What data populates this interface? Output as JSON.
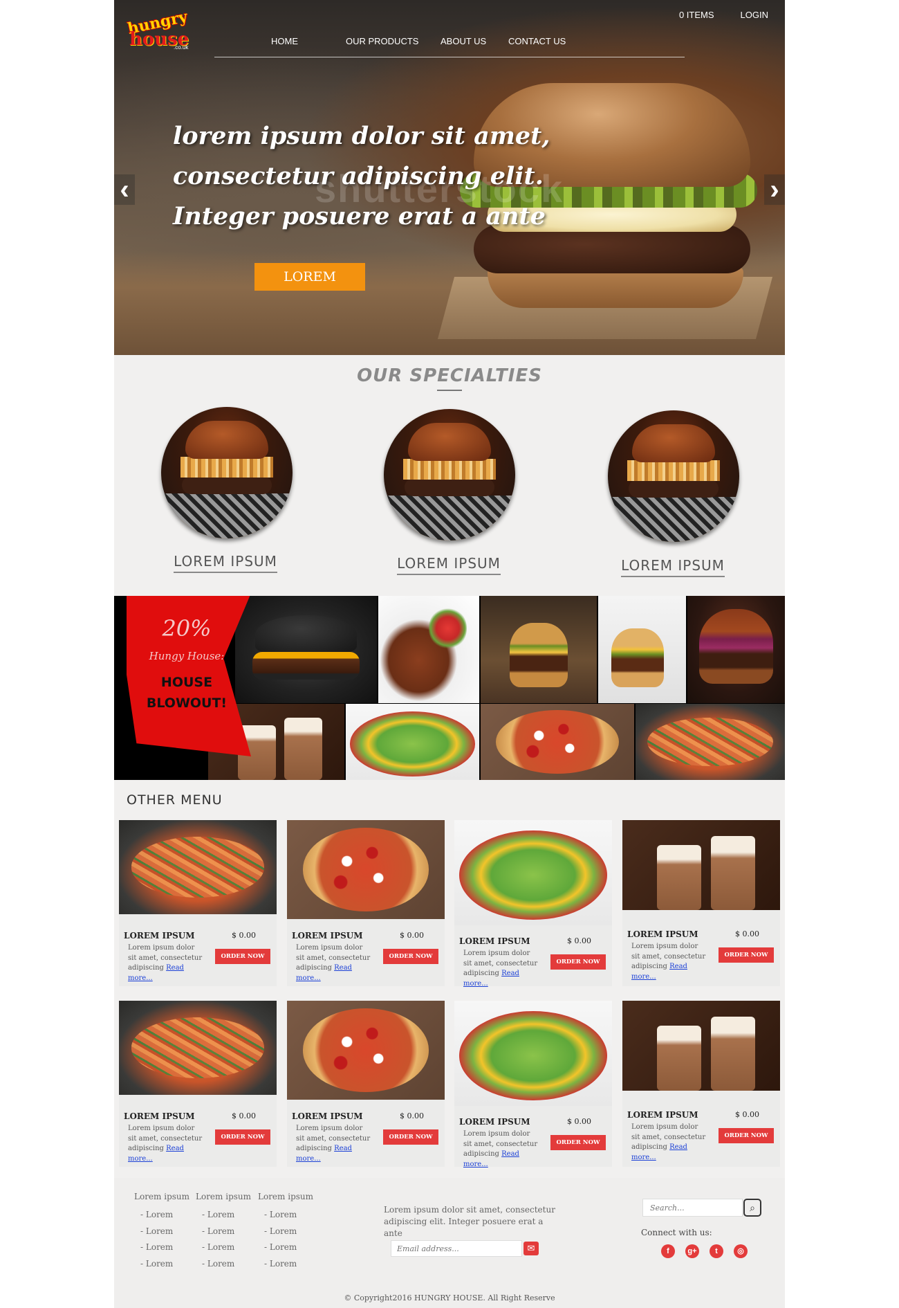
{
  "brand": {
    "logo_line1": "hungry",
    "logo_line2": "house",
    "logo_domain": ".co.uk"
  },
  "topbar": {
    "items_count": "0 ITEMS",
    "login": "LOGIN"
  },
  "nav": [
    "HOME",
    "OUR PRODUCTS",
    "ABOUT US",
    "CONTACT US"
  ],
  "hero": {
    "lines": [
      "lorem ipsum dolor sit amet,",
      "consectetur adipiscing elit.",
      "Integer posuere erat a ante"
    ],
    "button": "LOREM",
    "watermark": "shutterstock",
    "prev_icon": "chevron-left-icon",
    "next_icon": "chevron-right-icon"
  },
  "specialties": {
    "title": "OUR SPECIALTIES",
    "items": [
      "LOREM IPSUM",
      "LOREM IPSUM",
      "LOREM IPSUM"
    ]
  },
  "promo": {
    "discount": "20%",
    "subtitle": "Hungy House:",
    "headline_1": "HOUSE",
    "headline_2": "BLOWOUT!"
  },
  "other_menu": {
    "title": "OTHER MENU",
    "cards": [
      {
        "name": "LOREM IPSUM",
        "price": "$ 0.00",
        "desc": "Lorem ipsum dolor sit amet, consectetur adipiscing",
        "link": "Read more...",
        "button": "ORDER NOW",
        "food": "pasta"
      },
      {
        "name": "LOREM IPSUM",
        "price": "$ 0.00",
        "desc": "Lorem ipsum dolor sit amet, consectetur adipiscing",
        "link": "Read more...",
        "button": "ORDER NOW",
        "food": "pizza"
      },
      {
        "name": "LOREM IPSUM",
        "price": "$ 0.00",
        "desc": "Lorem ipsum dolor sit amet, consectetur adipiscing",
        "link": "Read more...",
        "button": "ORDER NOW",
        "food": "salad"
      },
      {
        "name": "LOREM IPSUM",
        "price": "$ 0.00",
        "desc": "Lorem ipsum dolor sit amet, consectetur adipiscing",
        "link": "Read more...",
        "button": "ORDER NOW",
        "food": "shake"
      },
      {
        "name": "LOREM IPSUM",
        "price": "$ 0.00",
        "desc": "Lorem ipsum dolor sit amet, consectetur adipiscing",
        "link": "Read more...",
        "button": "ORDER NOW",
        "food": "pasta"
      },
      {
        "name": "LOREM IPSUM",
        "price": "$ 0.00",
        "desc": "Lorem ipsum dolor sit amet, consectetur adipiscing",
        "link": "Read more...",
        "button": "ORDER NOW",
        "food": "pizza"
      },
      {
        "name": "LOREM IPSUM",
        "price": "$ 0.00",
        "desc": "Lorem ipsum dolor sit amet, consectetur adipiscing",
        "link": "Read more...",
        "button": "ORDER NOW",
        "food": "salad"
      },
      {
        "name": "LOREM IPSUM",
        "price": "$ 0.00",
        "desc": "Lorem ipsum dolor sit amet, consectetur adipiscing",
        "link": "Read more...",
        "button": "ORDER NOW",
        "food": "shake"
      }
    ]
  },
  "footer": {
    "columns": [
      {
        "heading": "Lorem ipsum",
        "items": [
          "- Lorem",
          "- Lorem",
          "- Lorem",
          "- Lorem"
        ]
      },
      {
        "heading": "Lorem ipsum",
        "items": [
          "- Lorem",
          "- Lorem",
          "- Lorem",
          "- Lorem"
        ]
      },
      {
        "heading": "Lorem ipsum",
        "items": [
          "- Lorem",
          "- Lorem",
          "- Lorem",
          "- Lorem"
        ]
      }
    ],
    "blurb": "Lorem ipsum dolor sit amet, consectetur adipiscing elit. Integer posuere erat a ante",
    "email_placeholder": "Email address...",
    "search_placeholder": "Search...",
    "connect": "Connect with us:",
    "social": [
      {
        "icon": "facebook-icon",
        "glyph": "f"
      },
      {
        "icon": "google-plus-icon",
        "glyph": "g+"
      },
      {
        "icon": "twitter-icon",
        "glyph": "t"
      },
      {
        "icon": "instagram-icon",
        "glyph": "◎"
      }
    ],
    "copyright": "© Copyright2016 HUNGRY HOUSE. All Right Reserve"
  },
  "colors": {
    "accent_orange": "#f3920f",
    "accent_red": "#e33b3b",
    "promo_red": "#e00d0d",
    "page_bg": "#f1f0ef"
  }
}
